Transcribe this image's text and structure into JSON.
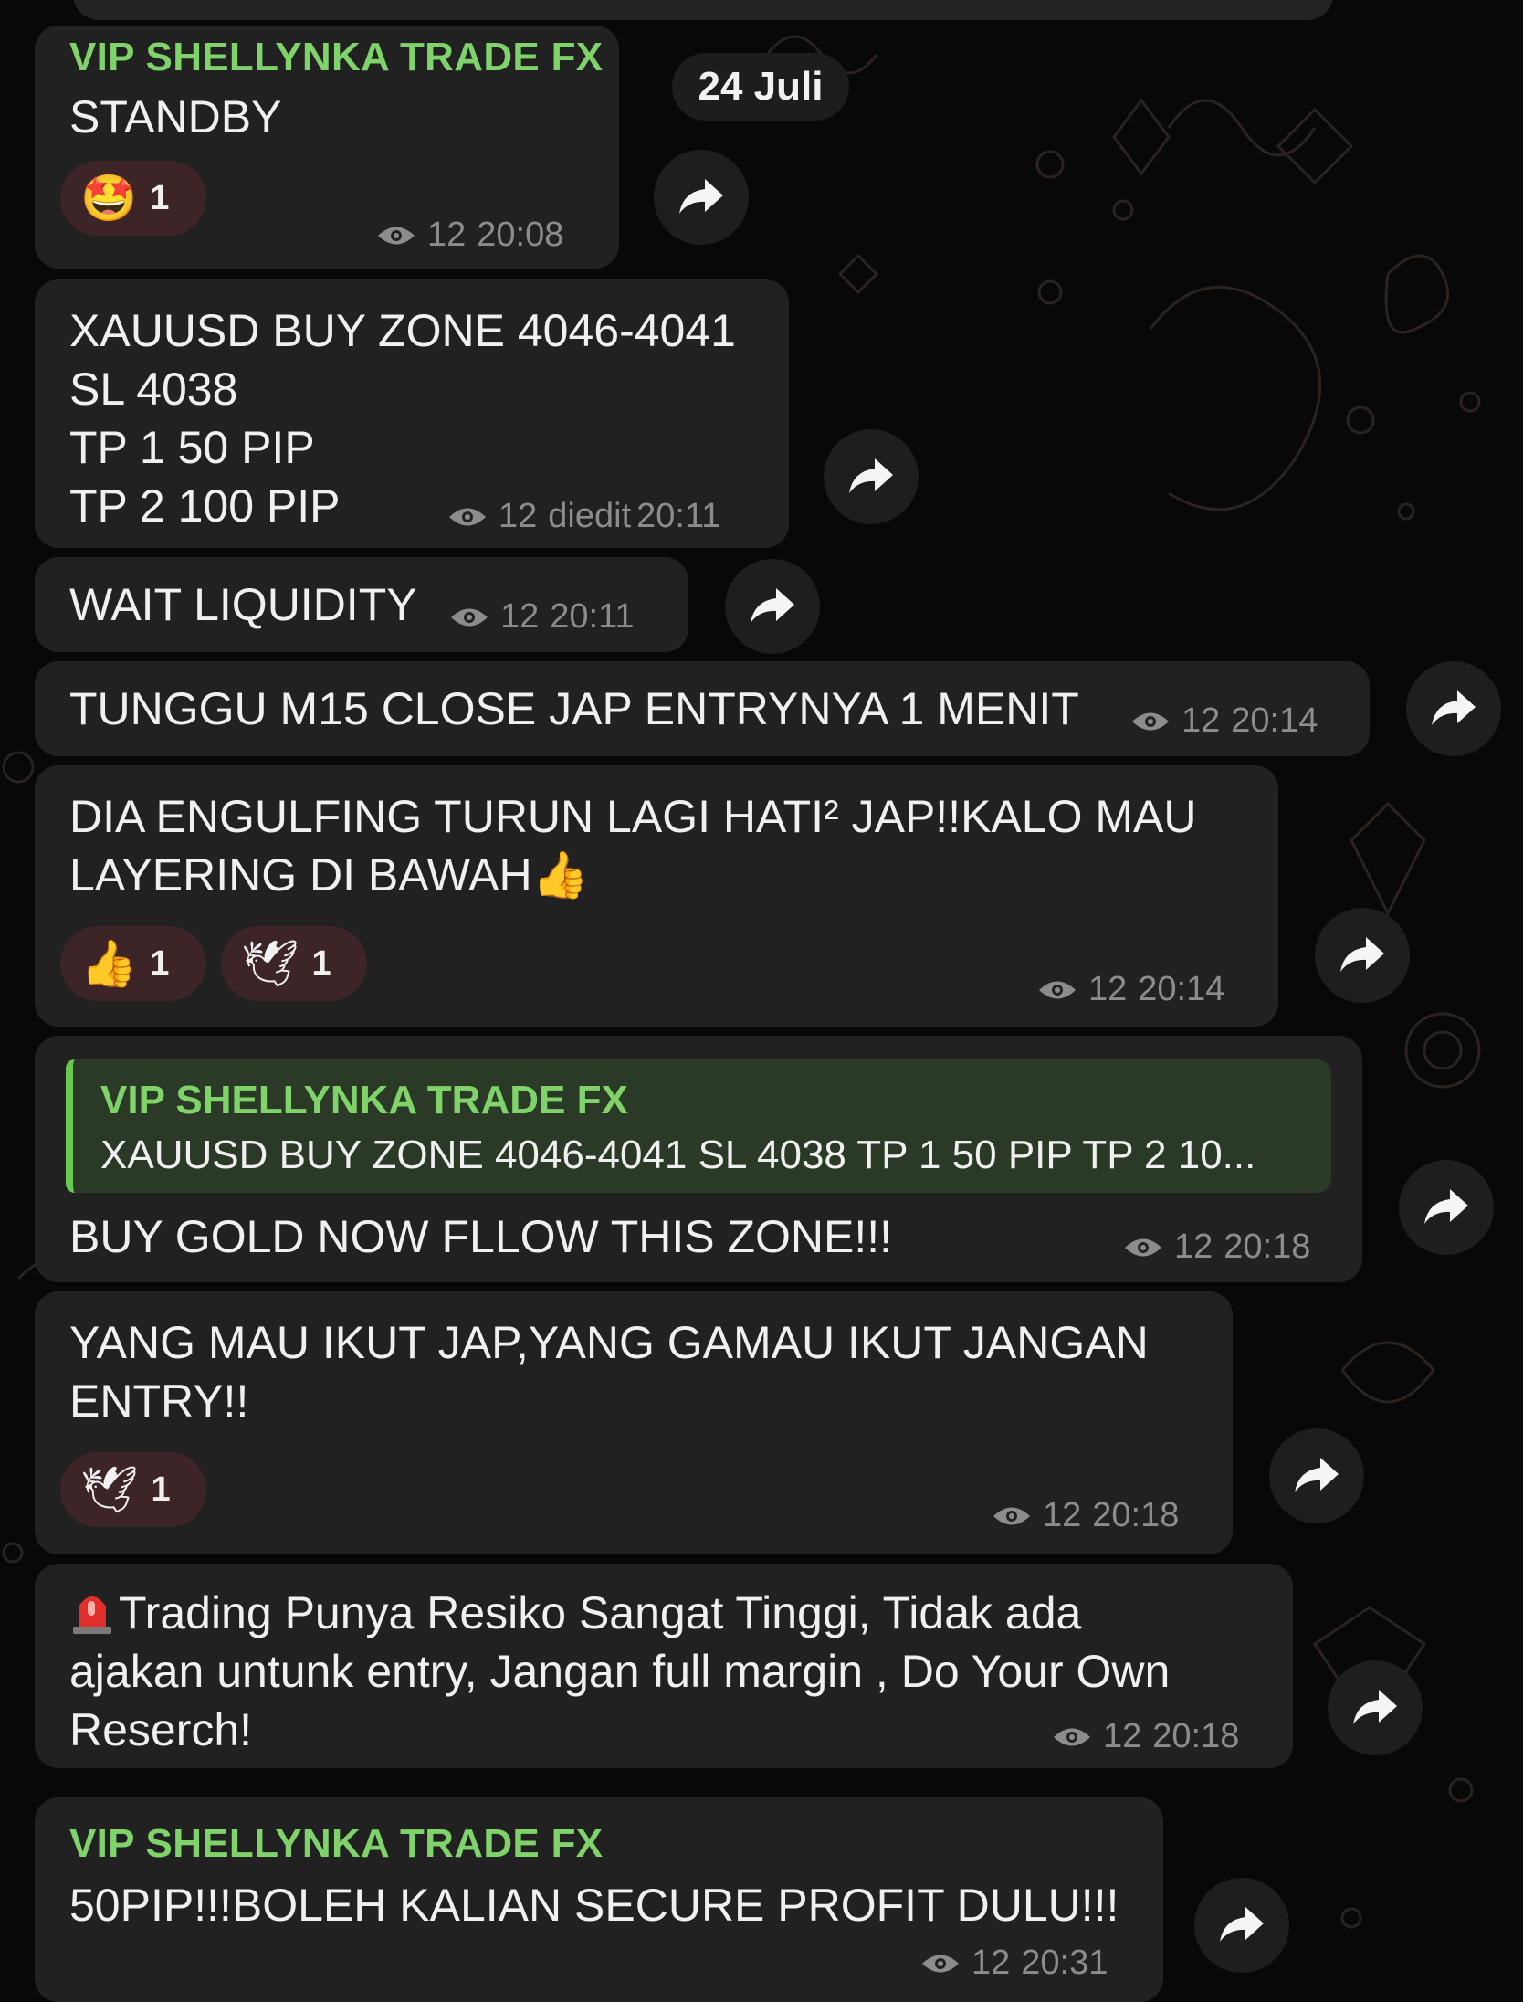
{
  "date_badge": "24 Juli",
  "messages": [
    {
      "sender": "VIP SHELLYNKA TRADE FX",
      "text": "STANDBY",
      "reactions": [
        {
          "emoji": "🤩",
          "count": "1"
        }
      ],
      "views": "12",
      "time": "20:08"
    },
    {
      "text": "XAUUSD BUY ZONE 4046-4041\nSL 4038\nTP 1 50 PIP\nTP 2 100 PIP",
      "views": "12",
      "edited": "diedit",
      "time": "20:11"
    },
    {
      "text": "WAIT LIQUIDITY",
      "views": "12",
      "time": "20:11"
    },
    {
      "text": "TUNGGU M15 CLOSE JAP ENTRYNYA 1 MENIT",
      "views": "12",
      "time": "20:14"
    },
    {
      "text": "DIA ENGULFING TURUN LAGI HATI² JAP!!KALO MAU\nLAYERING DI BAWAH👍",
      "reactions": [
        {
          "emoji": "👍",
          "count": "1"
        },
        {
          "emoji": "🕊",
          "count": "1"
        }
      ],
      "views": "12",
      "time": "20:14"
    },
    {
      "reply_to": {
        "sender": "VIP SHELLYNKA TRADE FX",
        "text": "XAUUSD BUY ZONE 4046-4041 SL 4038 TP 1 50 PIP  TP 2 10..."
      },
      "text": "BUY GOLD NOW FLLOW THIS ZONE!!!",
      "views": "12",
      "time": "20:18"
    },
    {
      "text": "YANG MAU IKUT JAP,YANG GAMAU IKUT JANGAN\nENTRY!!",
      "reactions": [
        {
          "emoji": "🕊",
          "count": "1"
        }
      ],
      "views": "12",
      "time": "20:18"
    },
    {
      "text_prefix_icon": "siren-icon",
      "text": "Trading Punya Resiko Sangat Tinggi, Tidak ada\najakan untunk entry, Jangan full margin , Do Your Own\nReserch!",
      "views": "12",
      "time": "20:18"
    },
    {
      "sender": "VIP SHELLYNKA TRADE FX",
      "text": "50PIP!!!BOLEH KALIAN SECURE PROFIT DULU!!!",
      "views": "12",
      "time": "20:31"
    }
  ],
  "colors": {
    "background": "#080808",
    "bubble": "#212121",
    "sender_name": "#7fd36a",
    "reaction_bg": "#3d2527",
    "meta": "#8c8c8c"
  }
}
